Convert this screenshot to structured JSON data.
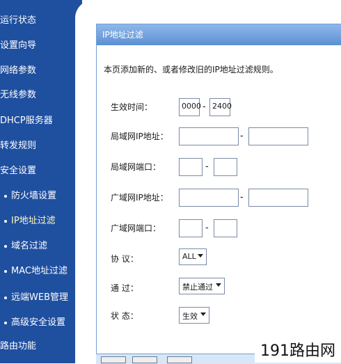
{
  "sidebar": {
    "items": [
      {
        "label": "运行状态",
        "sub": false
      },
      {
        "label": "设置向导",
        "sub": false
      },
      {
        "label": "网络参数",
        "sub": false
      },
      {
        "label": "无线参数",
        "sub": false
      },
      {
        "label": "DHCP服务器",
        "sub": false
      },
      {
        "label": "转发规则",
        "sub": false
      },
      {
        "label": "安全设置",
        "sub": false
      },
      {
        "label": "防火墙设置",
        "sub": true
      },
      {
        "label": "IP地址过滤",
        "sub": true,
        "active": true
      },
      {
        "label": "域名过滤",
        "sub": true
      },
      {
        "label": "MAC地址过滤",
        "sub": true
      },
      {
        "label": "远端WEB管理",
        "sub": true
      },
      {
        "label": "高级安全设置",
        "sub": true
      },
      {
        "label": "路由功能",
        "sub": false
      }
    ]
  },
  "panel": {
    "title": "IP地址过滤",
    "description": "本页添加新的、或者修改旧的IP地址过滤规则。"
  },
  "form": {
    "effective_time_label": "生效时间：",
    "time_start": "0000",
    "time_end": "2400",
    "lan_ip_label": "局域网IP地址：",
    "lan_port_label": "局域网端口：",
    "wan_ip_label": "广域网IP地址：",
    "wan_port_label": "广域网端口：",
    "protocol_label": "协  议：",
    "protocol_value": "ALL",
    "pass_label": "通  过：",
    "pass_value": "禁止通过",
    "status_label": "状  态：",
    "status_value": "生效",
    "dash": "-"
  },
  "watermark": "191路由网",
  "colors": {
    "sidebar_bg": "#1f4f9f",
    "header_gradient_top": "#8fb8ea",
    "header_gradient_bottom": "#5c8fd2"
  }
}
